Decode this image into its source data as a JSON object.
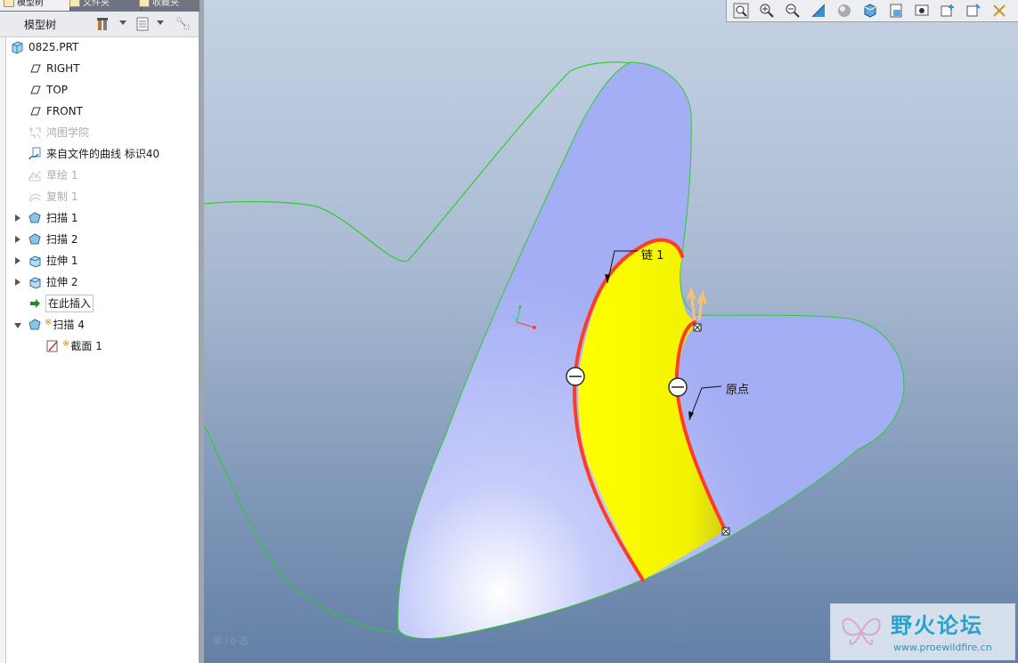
{
  "panel": {
    "tabs": [
      {
        "label": "模型树",
        "active": true
      },
      {
        "label": "文件夹",
        "active": false
      },
      {
        "label": "收藏夹",
        "active": false
      }
    ],
    "title": "模型树"
  },
  "tree": {
    "items": [
      {
        "label": "0825.PRT"
      },
      {
        "label": "RIGHT"
      },
      {
        "label": "TOP"
      },
      {
        "label": "FRONT"
      },
      {
        "label": "鸿图学院"
      },
      {
        "label": "来自文件的曲线 标识40"
      },
      {
        "label": "草绘 1"
      },
      {
        "label": "复制 1"
      },
      {
        "label": "扫描 1"
      },
      {
        "label": "扫描 2"
      },
      {
        "label": "拉伸 1"
      },
      {
        "label": "拉伸 2"
      },
      {
        "label": "在此插入"
      },
      {
        "label": "扫描 4",
        "marker": "※"
      },
      {
        "label": "截面 1",
        "marker": "※"
      }
    ]
  },
  "viewport": {
    "labels": {
      "chain": "链 1",
      "origin": "原点"
    },
    "status": "第 / 0 选"
  },
  "watermark": {
    "brand": "野火论坛",
    "url": "www.proewildfire.cn"
  },
  "colors": {
    "surface": "#a3aef4",
    "highlight": "#ffff00",
    "edge": "#ff3b2a",
    "curve": "#2ecc2e"
  }
}
